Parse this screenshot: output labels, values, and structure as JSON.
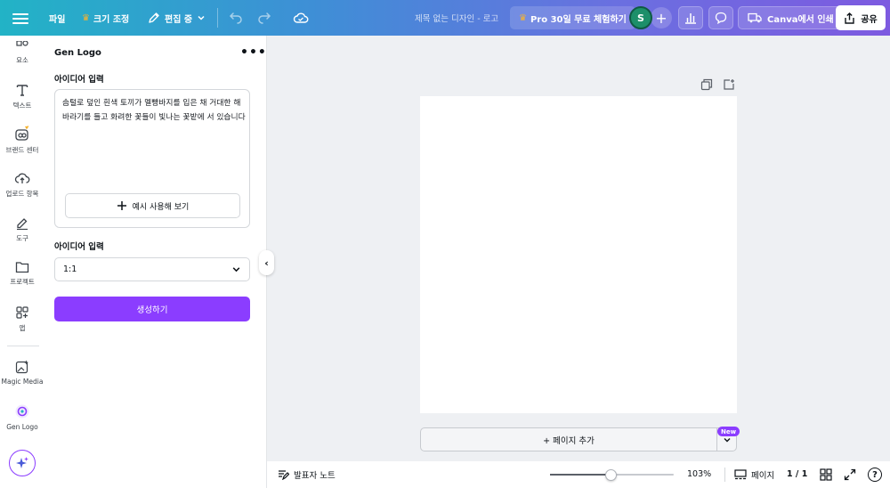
{
  "topbar": {
    "file_label": "파일",
    "resize_label": "크기 조정",
    "edit_label": "편집 중",
    "doc_title": "제목 없는 디자인 - 로고",
    "pro_trial_label": "Pro 30일 무료 체험하기",
    "avatar_initial": "S",
    "print_label": "Canva에서 인쇄",
    "share_label": "공유"
  },
  "rail": {
    "items": [
      {
        "label": "요소",
        "icon": "elements-icon"
      },
      {
        "label": "텍스트",
        "icon": "text-icon"
      },
      {
        "label": "브랜드 센터",
        "icon": "brand-icon"
      },
      {
        "label": "업로드 항목",
        "icon": "upload-icon"
      },
      {
        "label": "도구",
        "icon": "draw-icon"
      },
      {
        "label": "프로젝트",
        "icon": "folder-icon"
      },
      {
        "label": "앱",
        "icon": "apps-icon"
      },
      {
        "label": "Magic Media",
        "icon": "magic-media-icon"
      },
      {
        "label": "Gen Logo",
        "icon": "gen-logo-icon"
      }
    ]
  },
  "panel": {
    "title": "Gen Logo",
    "idea_label": "아이디어 입력",
    "idea_text": "솜털로 덮인 흰색 토끼가 멜빵바지를 입은 채 거대한 해바라기를 들고 화려한 꽃들이 빛나는 꽃밭에 서 있습니다",
    "example_button": "예시 사용해 보기",
    "ratio_label": "아이디어 입력",
    "ratio_value": "1:1",
    "generate_button": "생성하기"
  },
  "canvas": {
    "add_page_label": "+ 페이지 추가",
    "new_badge": "New"
  },
  "bottombar": {
    "notes_label": "발표자 노트",
    "zoom_percent": 103,
    "zoom_label": "103%",
    "pages_label": "페이지",
    "page_count": "1 / 1",
    "help_label": "?"
  },
  "colors": {
    "accent": "#8b3dff",
    "topbar_start": "#22b3c6",
    "topbar_end": "#7d5ae0",
    "crown": "#f5b331",
    "avatar": "#1d8f6a"
  }
}
